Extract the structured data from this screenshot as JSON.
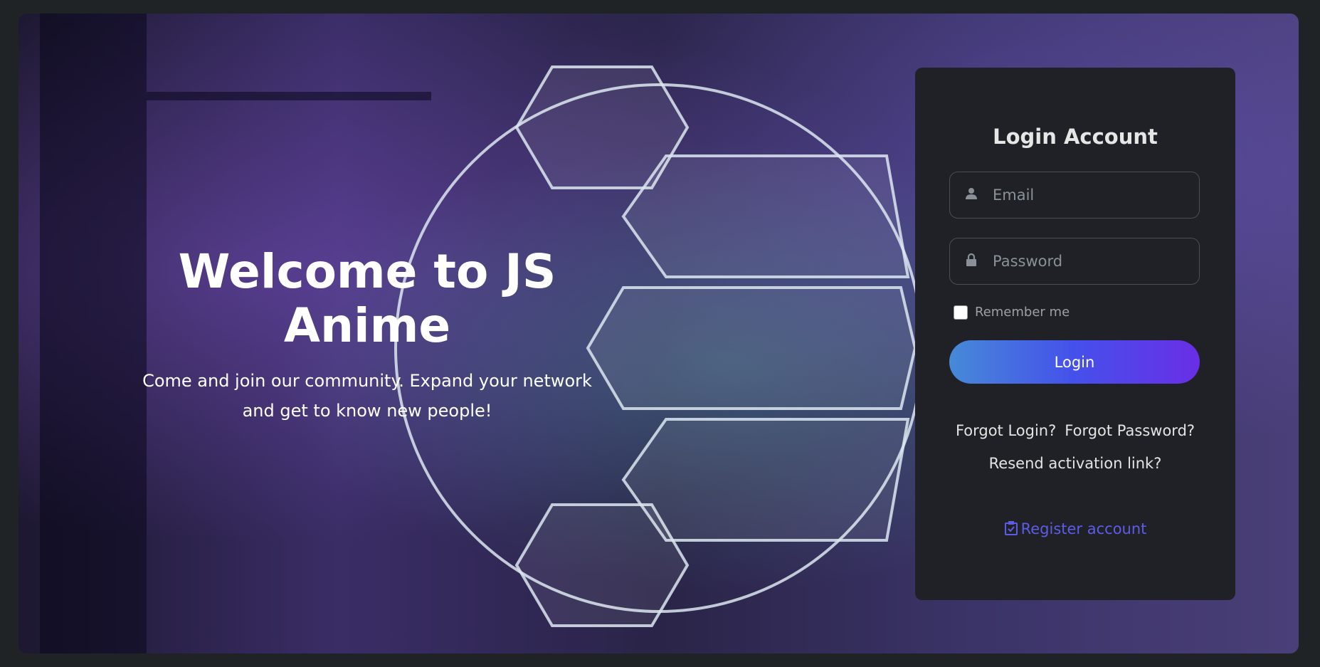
{
  "hero": {
    "title": "Welcome to JS Anime",
    "subtitle_line1": "Come and join our community. Expand your network",
    "subtitle_line2": "and get to know new people!"
  },
  "login": {
    "title": "Login Account",
    "email_placeholder": "Email",
    "password_placeholder": "Password",
    "remember_label": "Remember me",
    "remember_checked": false,
    "login_button": "Login",
    "forgot_login": "Forgot Login?",
    "forgot_password": "Forgot Password?",
    "resend": "Resend activation link?",
    "register": "Register account"
  },
  "colors": {
    "accent": "#5e5ce6",
    "button_start": "#468ad8",
    "button_end": "#6a2ee6",
    "panel": "#1f2126"
  }
}
